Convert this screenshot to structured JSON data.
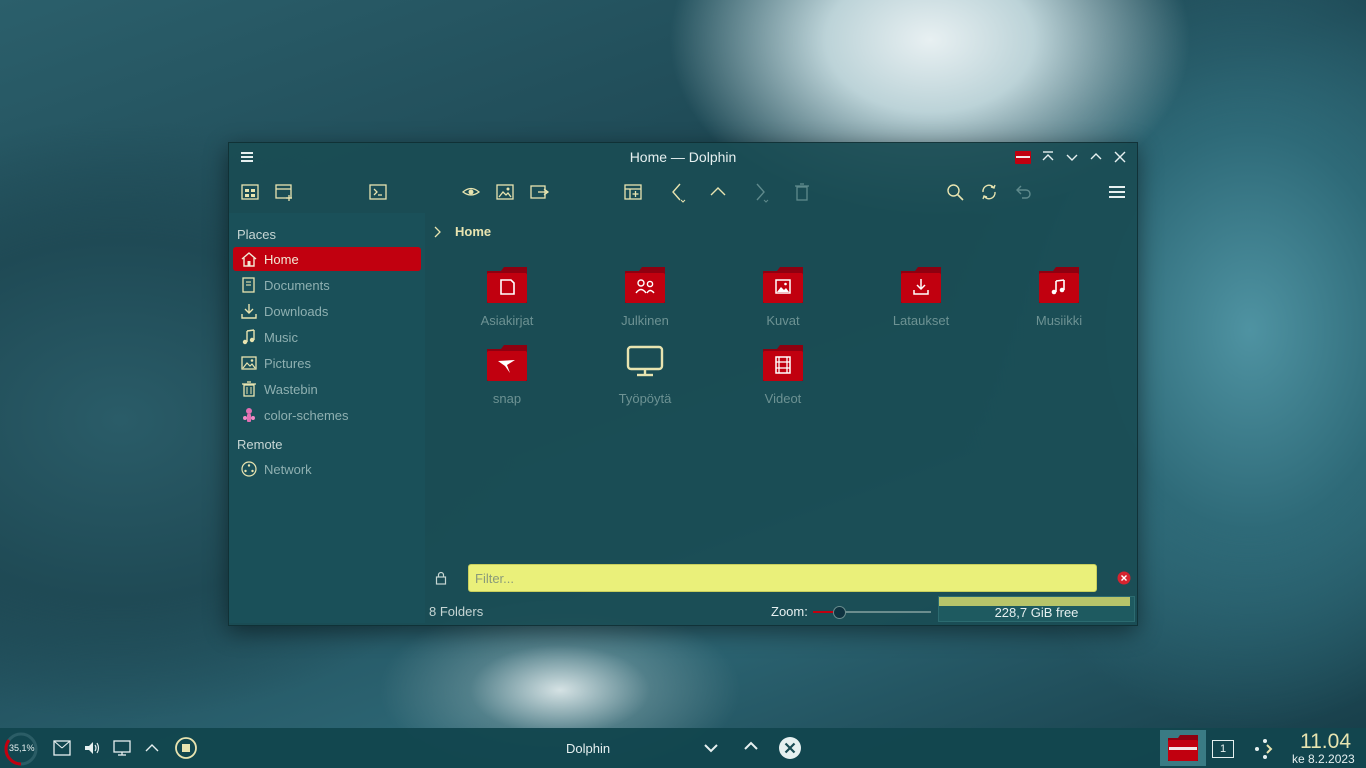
{
  "window": {
    "title": "Home — Dolphin"
  },
  "sidebar": {
    "places_header": "Places",
    "remote_header": "Remote",
    "items": [
      {
        "label": "Home",
        "icon": "home-icon",
        "active": true
      },
      {
        "label": "Documents",
        "icon": "documents-icon"
      },
      {
        "label": "Downloads",
        "icon": "downloads-icon"
      },
      {
        "label": "Music",
        "icon": "music-icon"
      },
      {
        "label": "Pictures",
        "icon": "pictures-icon"
      },
      {
        "label": "Wastebin",
        "icon": "wastebin-icon"
      },
      {
        "label": "color-schemes",
        "icon": "color-schemes-icon"
      }
    ],
    "remote_items": [
      {
        "label": "Network",
        "icon": "network-icon"
      }
    ]
  },
  "breadcrumb": {
    "current": "Home"
  },
  "files": [
    {
      "name": "Asiakirjat",
      "icon": "folder-documents-icon"
    },
    {
      "name": "Julkinen",
      "icon": "folder-public-icon"
    },
    {
      "name": "Kuvat",
      "icon": "folder-pictures-icon"
    },
    {
      "name": "Lataukset",
      "icon": "folder-downloads-icon"
    },
    {
      "name": "Musiikki",
      "icon": "folder-music-icon"
    },
    {
      "name": "snap",
      "icon": "folder-snap-icon"
    },
    {
      "name": "Työpöytä",
      "icon": "desktop-monitor-icon"
    },
    {
      "name": "Videot",
      "icon": "folder-videos-icon"
    }
  ],
  "filter": {
    "placeholder": "Filter..."
  },
  "status": {
    "summary": "8 Folders",
    "zoom_label": "Zoom:",
    "zoom_level": 0.22,
    "free_space": "228,7 GiB free",
    "used_fraction": 0.98
  },
  "taskbar": {
    "cpu_label": "35,1%",
    "cpu_fraction": 0.351,
    "task_title": "Dolphin",
    "pager_label": "1",
    "clock_time": "11.04",
    "clock_date": "ke 8.2.2023"
  },
  "colors": {
    "accent": "#c1000f",
    "text_highlight": "#e8e4b0",
    "filter_bg": "#eaf07a",
    "window_bg": "#1a4c54"
  }
}
